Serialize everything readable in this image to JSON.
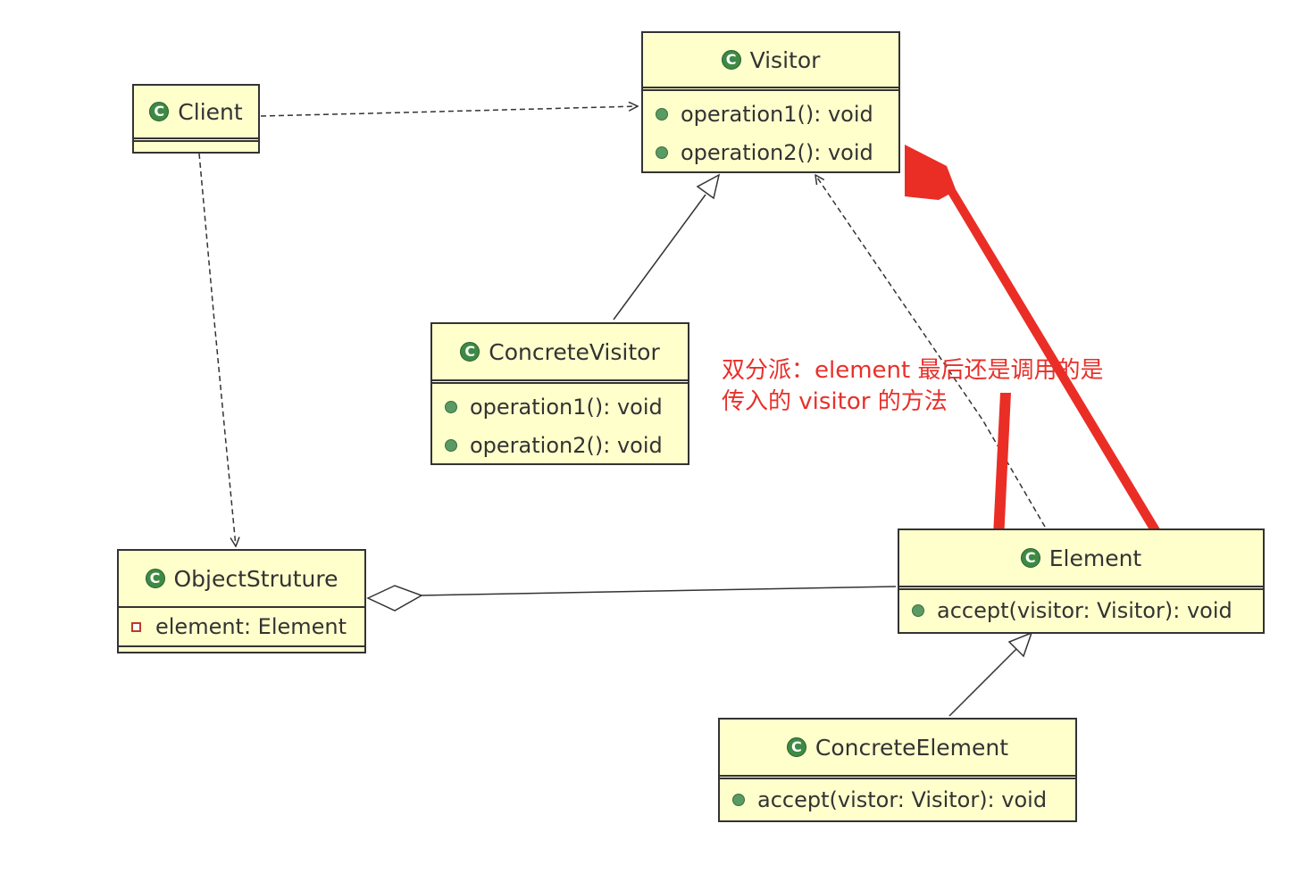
{
  "classes": {
    "client": {
      "name": "Client"
    },
    "visitor": {
      "name": "Visitor",
      "methods": [
        "operation1(): void",
        "operation2(): void"
      ]
    },
    "concrete_visitor": {
      "name": "ConcreteVisitor",
      "methods": [
        "operation1(): void",
        "operation2(): void"
      ]
    },
    "object_structure": {
      "name": "ObjectStruture",
      "fields": [
        "element: Element"
      ]
    },
    "element": {
      "name": "Element",
      "methods": [
        "accept(visitor: Visitor): void"
      ]
    },
    "concrete_element": {
      "name": "ConcreteElement",
      "methods": [
        "accept(vistor: Visitor): void"
      ]
    }
  },
  "class_icon_letter": "C",
  "annotation": {
    "line1": "双分派：element 最后还是调用的是",
    "line2": "传入的 visitor 的方法"
  },
  "colors": {
    "class_fill": "#ffffcc",
    "annotation": "#e8302a",
    "icon": "#3e8a44"
  }
}
